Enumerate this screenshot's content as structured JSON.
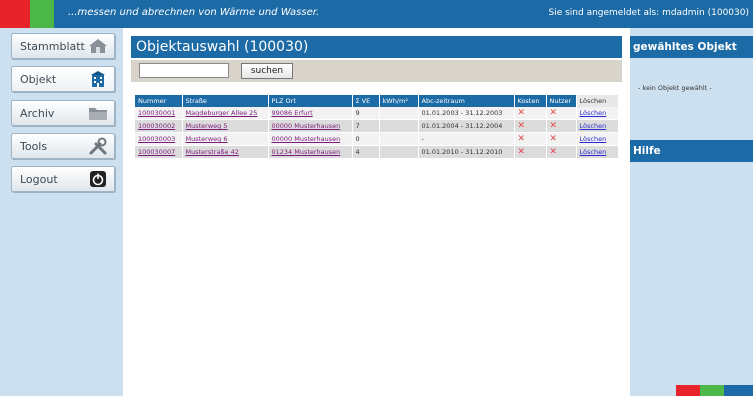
{
  "header": {
    "slogan": "...messen und abrechnen von Wärme und Wasser.",
    "login_status": "Sie sind angemeldet als: mdadmin (100030)"
  },
  "sidebar": {
    "items": [
      {
        "label": "Stammblatt",
        "icon": "house-icon"
      },
      {
        "label": "Objekt",
        "icon": "building-icon"
      },
      {
        "label": "Archiv",
        "icon": "folder-icon"
      },
      {
        "label": "Tools",
        "icon": "tools-icon"
      },
      {
        "label": "Logout",
        "icon": "logout-icon"
      }
    ]
  },
  "main": {
    "title": "Objektauswahl (100030)",
    "search": {
      "value": "",
      "placeholder": "",
      "button_label": "suchen"
    },
    "table": {
      "columns": [
        "Nummer",
        "Straße",
        "PLZ Ort",
        "Σ VE",
        "kWh/m²",
        "Abc-zeitraum",
        "Kosten",
        "Nutzer",
        "Löschen"
      ],
      "rows": [
        {
          "nummer": "100030001",
          "strasse": "Magdeburger Allee 25",
          "plz_ort": "99086 Erfurt",
          "ve": "9",
          "kwh": "",
          "zeitraum": "01.01.2003 - 31.12.2003",
          "kosten": "✕",
          "nutzer": "✕",
          "loeschen": "Löschen"
        },
        {
          "nummer": "100030002",
          "strasse": "Musterweg 5",
          "plz_ort": "00000 Musterhausen",
          "ve": "7",
          "kwh": "",
          "zeitraum": "01.01.2004 - 31.12.2004",
          "kosten": "✕",
          "nutzer": "✕",
          "loeschen": "Löschen"
        },
        {
          "nummer": "100030003",
          "strasse": "Musterweg 6",
          "plz_ort": "00000 Musterhausen",
          "ve": "0",
          "kwh": "",
          "zeitraum": "-",
          "kosten": "✕",
          "nutzer": "✕",
          "loeschen": "Löschen"
        },
        {
          "nummer": "100030007",
          "strasse": "Musterstraße 42",
          "plz_ort": "01234 Musterhausen",
          "ve": "4",
          "kwh": "",
          "zeitraum": "01.01.2010 - 31.12.2010",
          "kosten": "✕",
          "nutzer": "✕",
          "loeschen": "Löschen"
        }
      ]
    }
  },
  "right": {
    "selected_title": "gewähltes Objekt",
    "selected_text": "- kein Objekt gewählt -",
    "help_title": "Hilfe"
  },
  "colors": {
    "brand_blue": "#1c6aa6",
    "brand_red": "#e8242a",
    "brand_green": "#4db84a",
    "sidebar_bg": "#cde0f0"
  }
}
